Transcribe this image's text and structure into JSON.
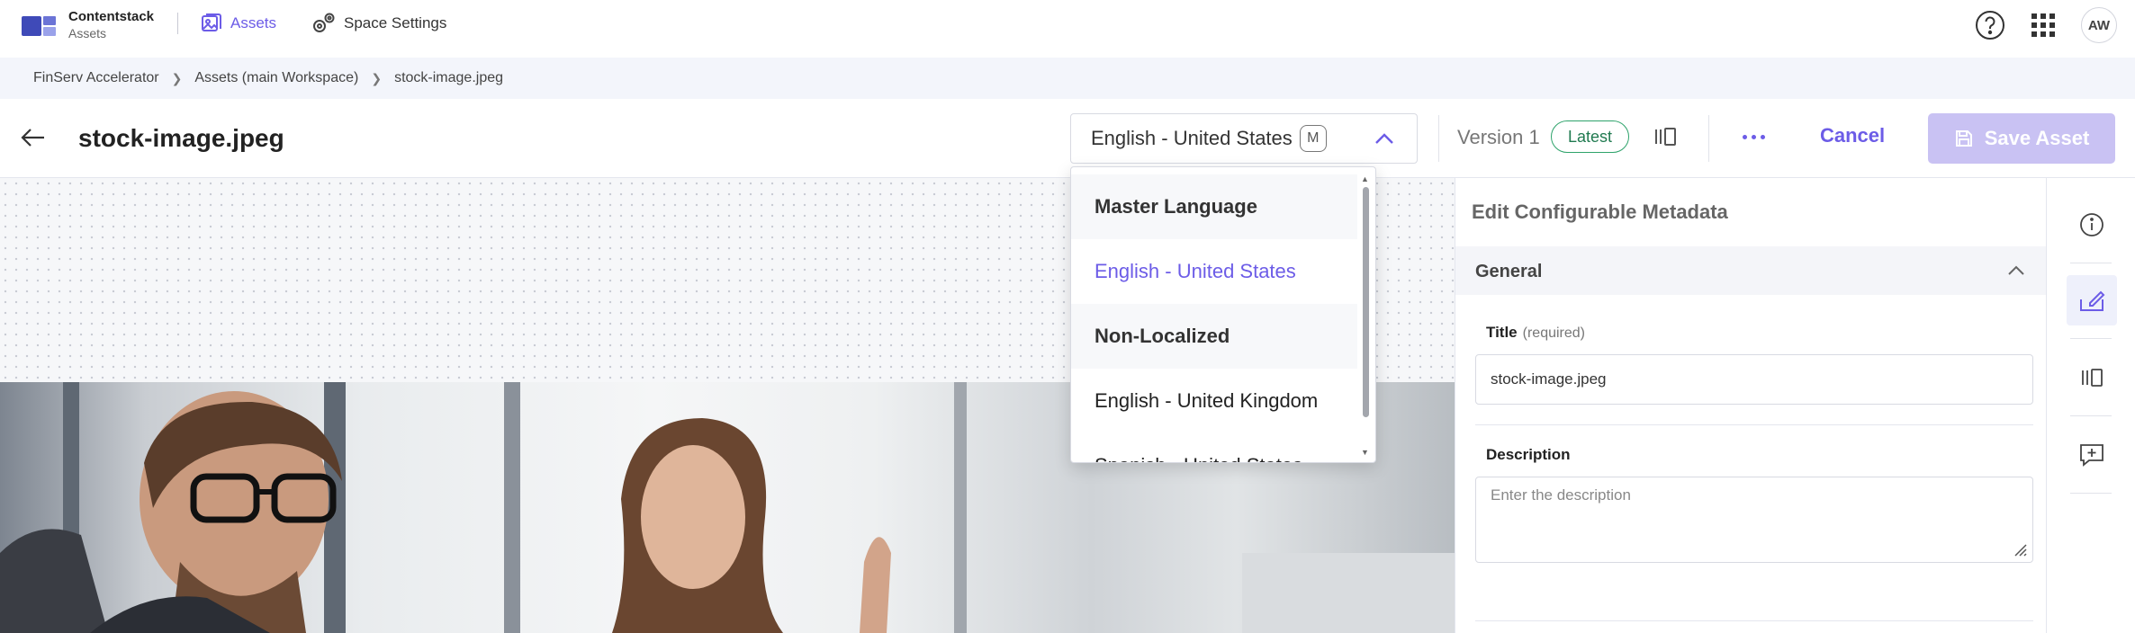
{
  "brand": {
    "name": "Contentstack",
    "product": "Assets"
  },
  "nav": {
    "assets_label": "Assets",
    "space_settings_label": "Space Settings"
  },
  "user": {
    "initials": "AW"
  },
  "breadcrumb": [
    "FinServ Accelerator",
    "Assets (main Workspace)",
    "stock-image.jpeg"
  ],
  "header": {
    "title": "stock-image.jpeg",
    "language_selected": "English - United States",
    "language_badge": "M",
    "version_label": "Version 1",
    "latest_badge": "Latest",
    "cancel_label": "Cancel",
    "save_label": "Save Asset"
  },
  "language_dropdown": {
    "options": [
      {
        "label": "Master Language",
        "kind": "group"
      },
      {
        "label": "English - United States",
        "kind": "selected"
      },
      {
        "label": "Non-Localized",
        "kind": "group"
      },
      {
        "label": "English - United Kingdom",
        "kind": "option"
      },
      {
        "label": "Spanish - United States",
        "kind": "option"
      }
    ]
  },
  "metadata_panel": {
    "title": "Edit Configurable Metadata",
    "section": "General",
    "title_field": {
      "label": "Title",
      "hint": "(required)",
      "value": "stock-image.jpeg"
    },
    "description_field": {
      "label": "Description",
      "placeholder": "Enter the description"
    }
  },
  "colors": {
    "accent": "#6c5ce7",
    "latest_green": "#2ea36b",
    "save_disabled": "#c9c2f3"
  },
  "rail_icons": [
    "info-icon",
    "edit-metadata-icon",
    "versions-icon",
    "comment-icon"
  ]
}
